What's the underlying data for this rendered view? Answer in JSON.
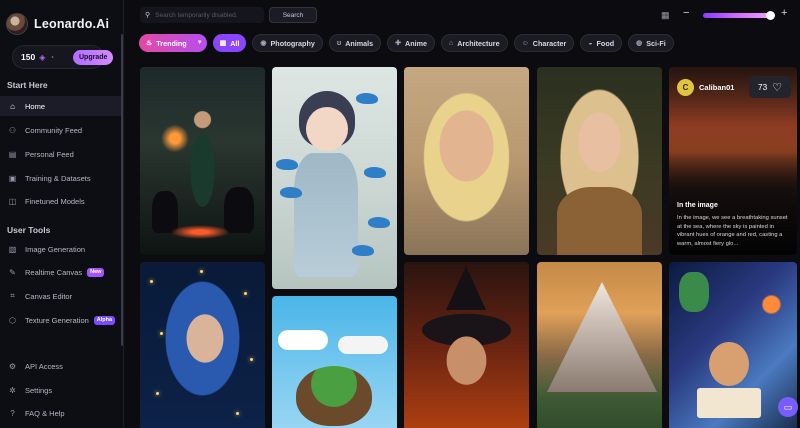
{
  "app": {
    "name": "Leonardo.Ai"
  },
  "account": {
    "tokens": "150",
    "upgrade_label": "Upgrade"
  },
  "sidebar": {
    "section_start": "Start Here",
    "start_items": [
      {
        "label": "Home",
        "icon": "home-icon",
        "active": true
      },
      {
        "label": "Community Feed",
        "icon": "people-icon"
      },
      {
        "label": "Personal Feed",
        "icon": "feed-icon"
      },
      {
        "label": "Training & Datasets",
        "icon": "dataset-icon"
      },
      {
        "label": "Finetuned Models",
        "icon": "model-icon"
      }
    ],
    "section_tools": "User Tools",
    "tool_items": [
      {
        "label": "Image Generation",
        "icon": "image-icon"
      },
      {
        "label": "Realtime Canvas",
        "icon": "canvas-icon",
        "badge": "New"
      },
      {
        "label": "Canvas Editor",
        "icon": "crop-icon"
      },
      {
        "label": "Texture Generation",
        "icon": "texture-icon",
        "badge": "Alpha"
      }
    ],
    "bottom_items": [
      {
        "label": "API Access",
        "icon": "api-icon"
      },
      {
        "label": "Settings",
        "icon": "gear-icon"
      },
      {
        "label": "FAQ & Help",
        "icon": "help-icon"
      }
    ]
  },
  "search": {
    "placeholder": "Search temporarily disabled.",
    "button_label": "Search"
  },
  "filters": [
    {
      "label": "Trending",
      "icon": "fire-icon"
    },
    {
      "label": "All",
      "icon": "grid-icon",
      "selected": true
    },
    {
      "label": "Photography",
      "icon": "camera-icon"
    },
    {
      "label": "Animals",
      "icon": "animal-icon"
    },
    {
      "label": "Anime",
      "icon": "sparkle-icon"
    },
    {
      "label": "Architecture",
      "icon": "building-icon"
    },
    {
      "label": "Character",
      "icon": "character-icon"
    },
    {
      "label": "Food",
      "icon": "food-icon"
    },
    {
      "label": "Sci-Fi",
      "icon": "planet-icon"
    }
  ],
  "hover_card": {
    "user_initial": "C",
    "username": "Caliban01",
    "likes": "73",
    "title": "In the image",
    "description": "In the image, we see a breathtaking sunset at the sea, where the sky is painted in vibrant hues of orange and red, casting a warm, almost fiery glo..."
  }
}
